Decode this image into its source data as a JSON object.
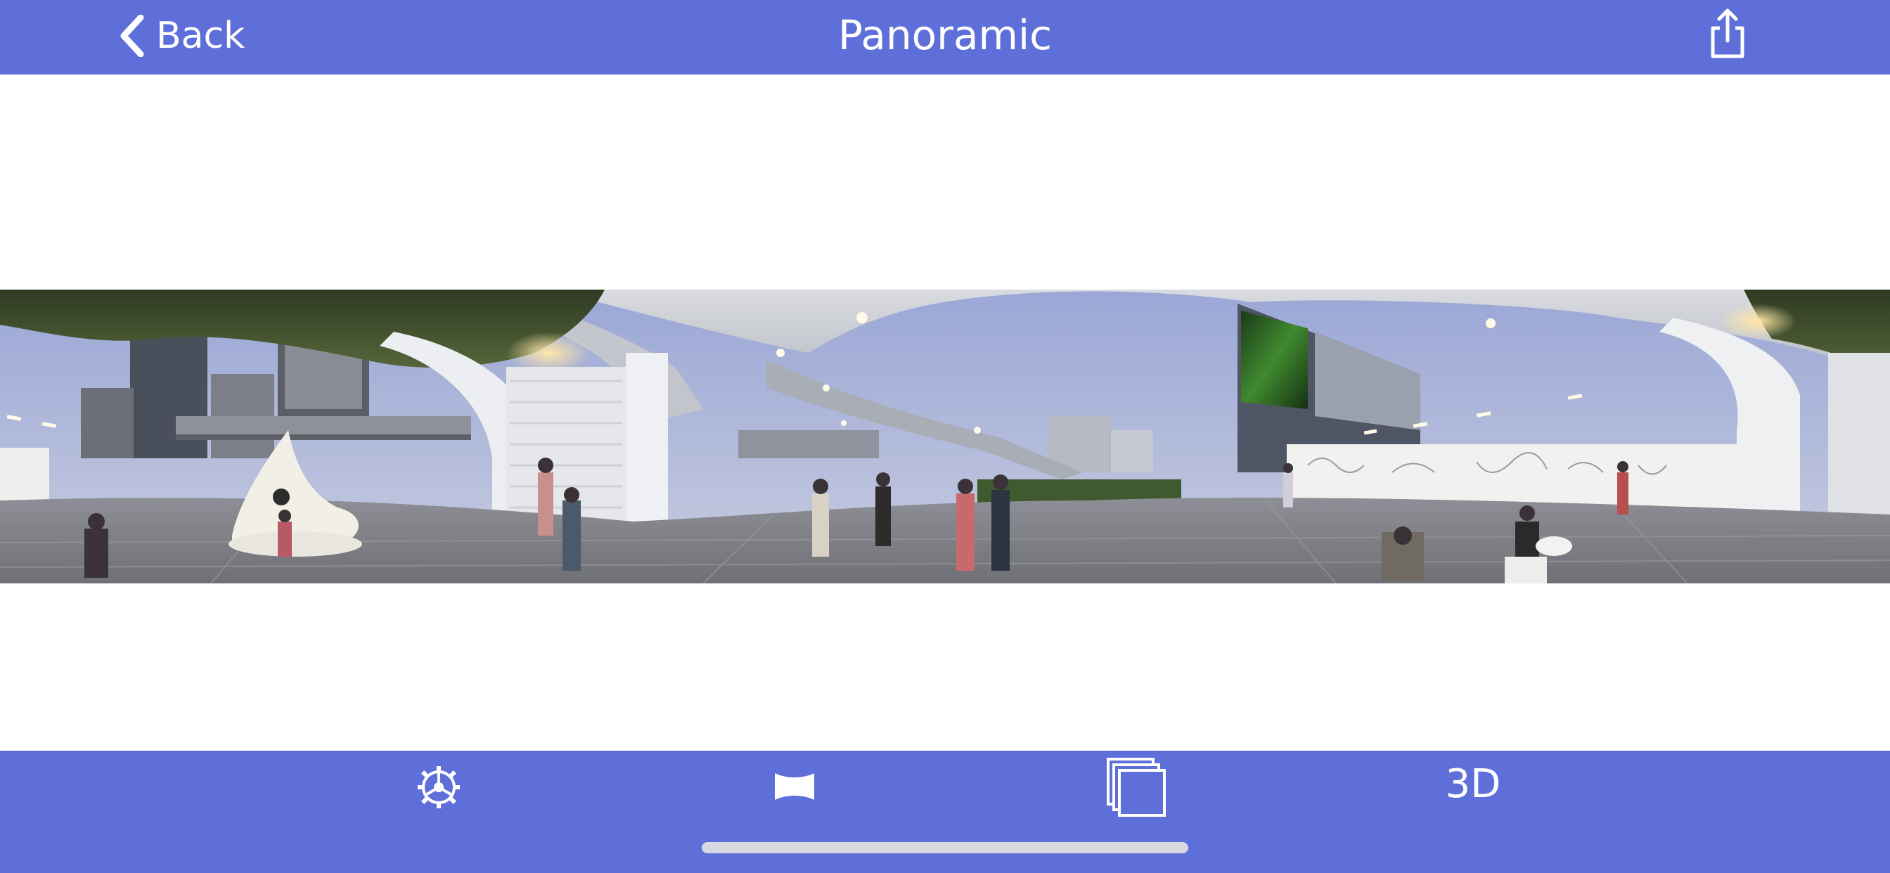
{
  "nav": {
    "back_label": "Back",
    "title": "Panoramic",
    "share_icon": "share-icon",
    "back_icon": "chevron-left-icon"
  },
  "toolbar": {
    "settings_icon": "gear-icon",
    "projection_icon": "projection-icon",
    "layers_icon": "layers-icon",
    "mode_3d_label": "3D"
  },
  "colors": {
    "bar_background": "#5f6fda",
    "icon_foreground": "#ffffff",
    "home_indicator": "#d7d8e0",
    "page_background": "#ffffff"
  }
}
